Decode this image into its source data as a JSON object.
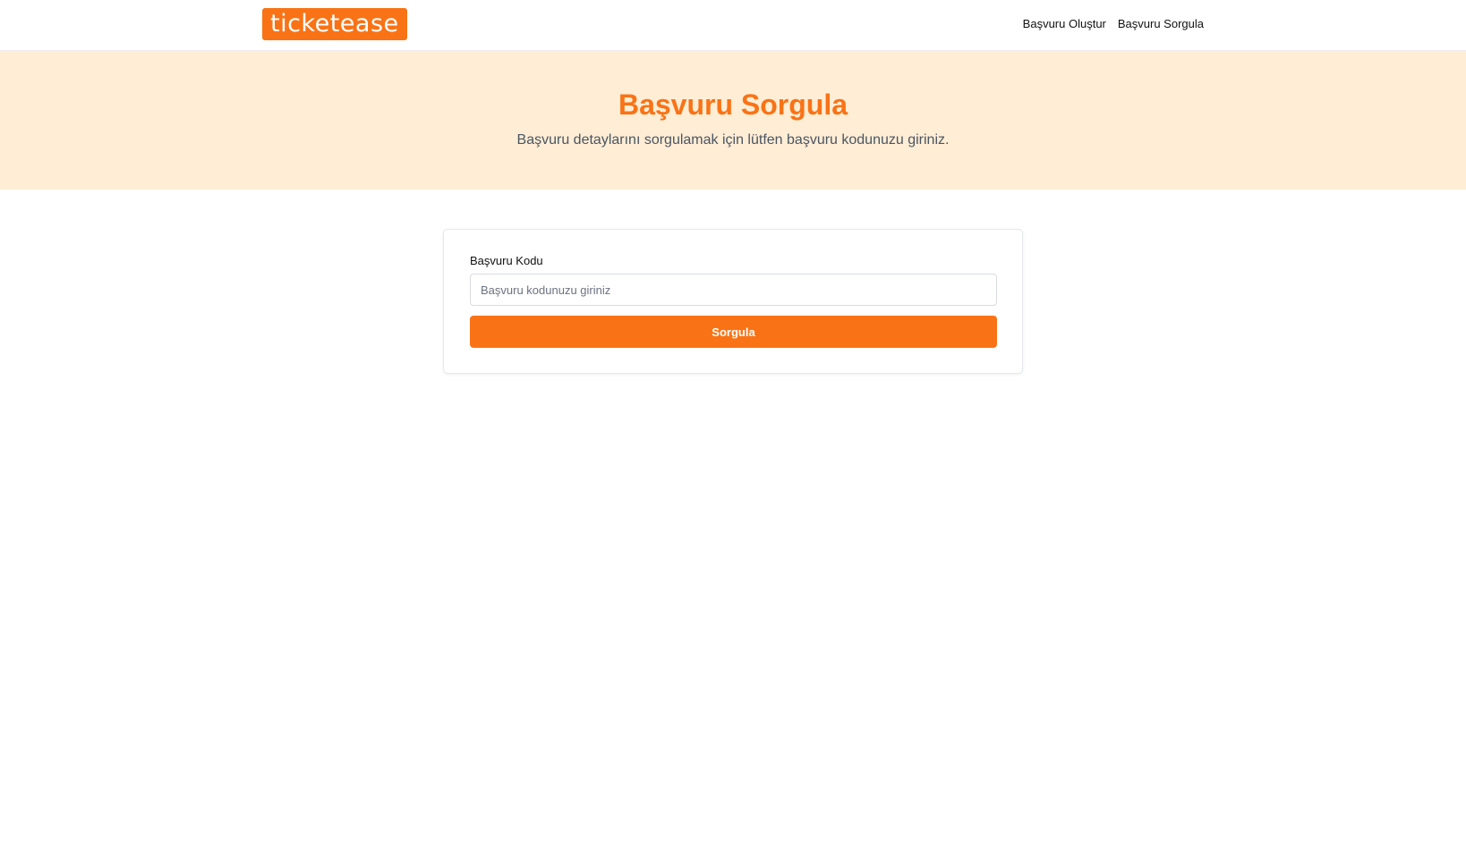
{
  "navbar": {
    "logo_text": "ticketease",
    "links": [
      {
        "label": "Başvuru Oluştur"
      },
      {
        "label": "Başvuru Sorgula"
      }
    ]
  },
  "hero": {
    "title": "Başvuru Sorgula",
    "subtitle": "Başvuru detaylarını sorgulamak için lütfen başvuru kodunuzu giriniz."
  },
  "form": {
    "code_label": "Başvuru Kodu",
    "code_value": "",
    "code_placeholder": "Başvuru kodunuzu giriniz",
    "submit_label": "Sorgula"
  },
  "colors": {
    "accent": "#f97316",
    "hero_background": "#ffedd5",
    "subtitle_text": "#4b5563"
  }
}
